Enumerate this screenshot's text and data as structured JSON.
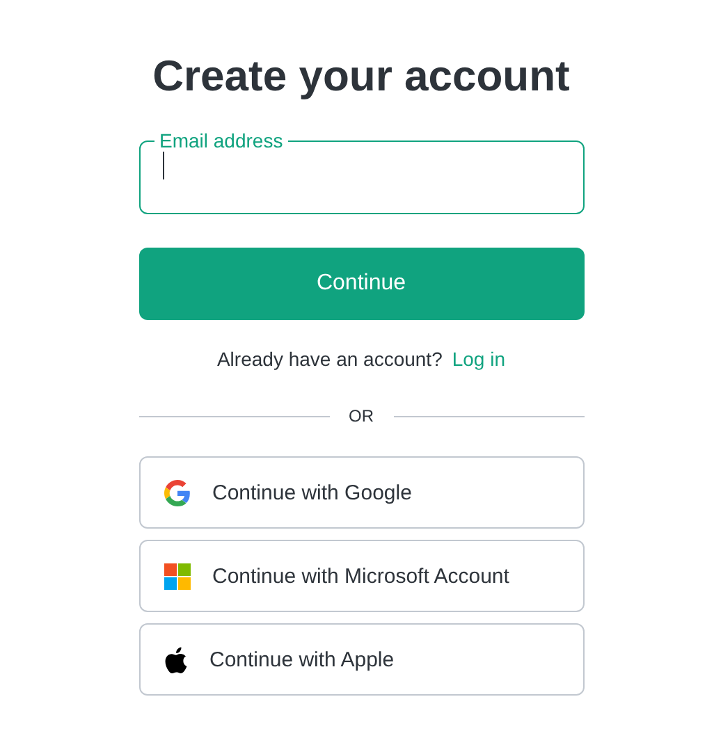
{
  "title": "Create your account",
  "email_field": {
    "label": "Email address",
    "focused": true
  },
  "continue_button": "Continue",
  "login_prompt": {
    "text": "Already have an account?",
    "link": "Log in"
  },
  "divider": "OR",
  "providers": [
    {
      "kind": "google",
      "label": "Continue with Google"
    },
    {
      "kind": "microsoft",
      "label": "Continue with Microsoft Account"
    },
    {
      "kind": "apple",
      "label": "Continue with Apple"
    }
  ]
}
